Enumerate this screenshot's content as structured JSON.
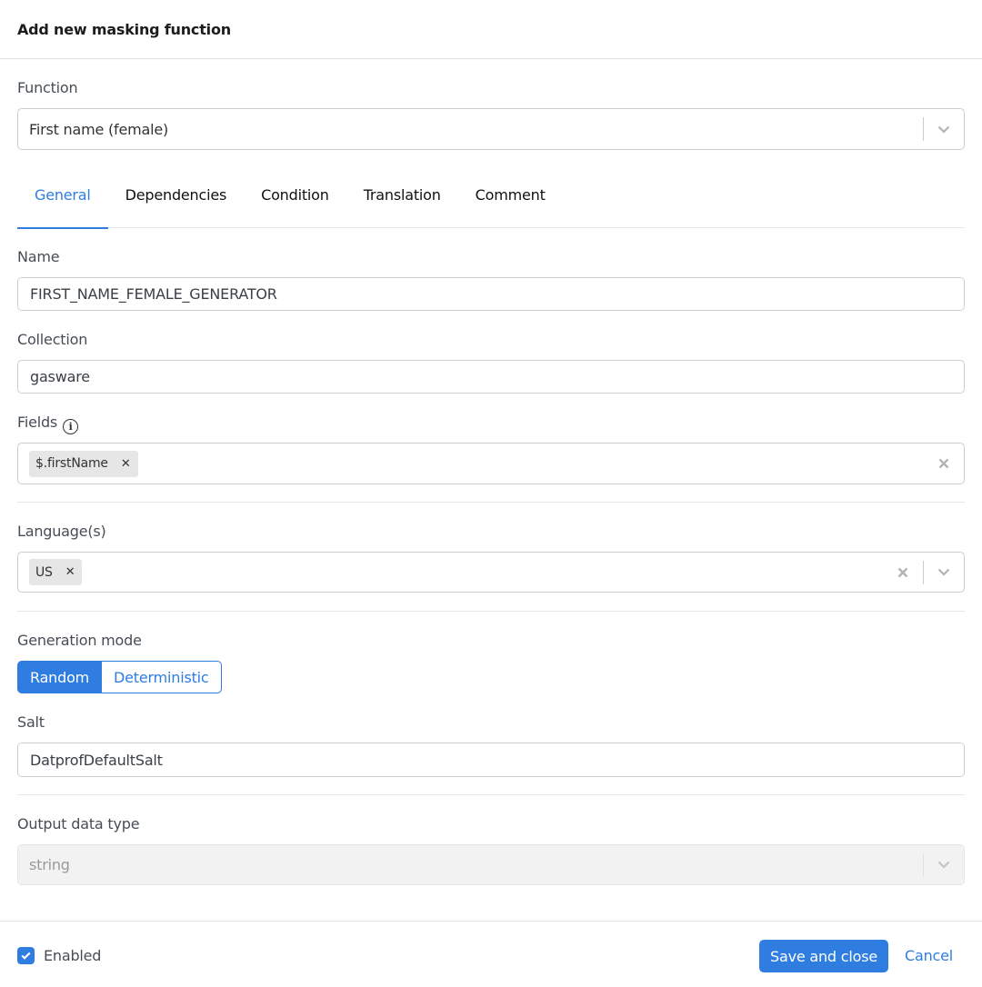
{
  "dialog": {
    "title": "Add new masking function"
  },
  "function": {
    "label": "Function",
    "value": "First name (female)"
  },
  "tabs": [
    {
      "label": "General",
      "active": true
    },
    {
      "label": "Dependencies",
      "active": false
    },
    {
      "label": "Condition",
      "active": false
    },
    {
      "label": "Translation",
      "active": false
    },
    {
      "label": "Comment",
      "active": false
    }
  ],
  "name": {
    "label": "Name",
    "value": "FIRST_NAME_FEMALE_GENERATOR"
  },
  "collection": {
    "label": "Collection",
    "value": "gasware"
  },
  "fields": {
    "label": "Fields",
    "info_icon": "info-icon",
    "chips": [
      "$.firstName"
    ],
    "remove_glyph": "✕"
  },
  "languages": {
    "label": "Language(s)",
    "chips": [
      "US"
    ]
  },
  "generation_mode": {
    "label": "Generation mode",
    "options": [
      "Random",
      "Deterministic"
    ],
    "selected": "Random"
  },
  "salt": {
    "label": "Salt",
    "value": "DatprofDefaultSalt"
  },
  "output_type": {
    "label": "Output data type",
    "value": "string",
    "disabled": true
  },
  "footer": {
    "enabled_label": "Enabled",
    "enabled": true,
    "save_label": "Save and close",
    "cancel_label": "Cancel"
  },
  "colors": {
    "accent": "#2f7de1",
    "border": "#cccccc",
    "chip_bg": "#e6e6e6",
    "disabled_bg": "#f2f2f2"
  }
}
